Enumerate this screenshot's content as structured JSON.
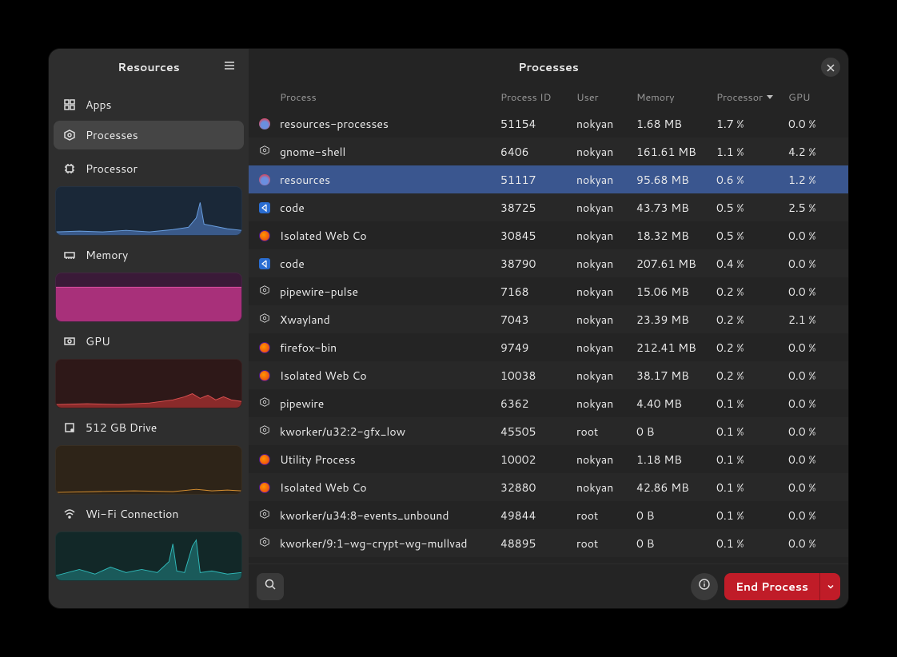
{
  "sidebar": {
    "title": "Resources",
    "apps_label": "Apps",
    "processes_label": "Processes",
    "metrics": {
      "processor": {
        "label": "Processor"
      },
      "memory": {
        "label": "Memory"
      },
      "gpu": {
        "label": "GPU"
      },
      "drive": {
        "label": "512 GB Drive"
      },
      "wifi": {
        "label": "Wi-Fi Connection"
      }
    }
  },
  "main": {
    "title": "Processes",
    "columns": {
      "process": "Process",
      "pid": "Process ID",
      "user": "User",
      "memory": "Memory",
      "cpu": "Processor",
      "gpu": "GPU"
    },
    "sort_column": "cpu",
    "selected_pid": "51117",
    "rows": [
      {
        "icon": "gauge",
        "name": "resources-processes",
        "pid": "51154",
        "user": "nokyan",
        "mem": "1.68 MB",
        "cpu": "1.7 %",
        "gpu": "0.0 %"
      },
      {
        "icon": "gear",
        "name": "gnome-shell",
        "pid": "6406",
        "user": "nokyan",
        "mem": "161.61 MB",
        "cpu": "1.1 %",
        "gpu": "4.2 %"
      },
      {
        "icon": "gauge",
        "name": "resources",
        "pid": "51117",
        "user": "nokyan",
        "mem": "95.68 MB",
        "cpu": "0.6 %",
        "gpu": "1.2 %"
      },
      {
        "icon": "code",
        "name": "code",
        "pid": "38725",
        "user": "nokyan",
        "mem": "43.73 MB",
        "cpu": "0.5 %",
        "gpu": "2.5 %"
      },
      {
        "icon": "firefox",
        "name": "Isolated Web Co",
        "pid": "30845",
        "user": "nokyan",
        "mem": "18.32 MB",
        "cpu": "0.5 %",
        "gpu": "0.0 %"
      },
      {
        "icon": "code",
        "name": "code",
        "pid": "38790",
        "user": "nokyan",
        "mem": "207.61 MB",
        "cpu": "0.4 %",
        "gpu": "0.0 %"
      },
      {
        "icon": "gear",
        "name": "pipewire-pulse",
        "pid": "7168",
        "user": "nokyan",
        "mem": "15.06 MB",
        "cpu": "0.2 %",
        "gpu": "0.0 %"
      },
      {
        "icon": "gear",
        "name": "Xwayland",
        "pid": "7043",
        "user": "nokyan",
        "mem": "23.39 MB",
        "cpu": "0.2 %",
        "gpu": "2.1 %"
      },
      {
        "icon": "firefox",
        "name": "firefox-bin",
        "pid": "9749",
        "user": "nokyan",
        "mem": "212.41 MB",
        "cpu": "0.2 %",
        "gpu": "0.0 %"
      },
      {
        "icon": "firefox",
        "name": "Isolated Web Co",
        "pid": "10038",
        "user": "nokyan",
        "mem": "38.17 MB",
        "cpu": "0.2 %",
        "gpu": "0.0 %"
      },
      {
        "icon": "gear",
        "name": "pipewire",
        "pid": "6362",
        "user": "nokyan",
        "mem": "4.40 MB",
        "cpu": "0.1 %",
        "gpu": "0.0 %"
      },
      {
        "icon": "gear",
        "name": "kworker/u32:2-gfx_low",
        "pid": "45505",
        "user": "root",
        "mem": "0 B",
        "cpu": "0.1 %",
        "gpu": "0.0 %"
      },
      {
        "icon": "firefox",
        "name": "Utility Process",
        "pid": "10002",
        "user": "nokyan",
        "mem": "1.18 MB",
        "cpu": "0.1 %",
        "gpu": "0.0 %"
      },
      {
        "icon": "firefox",
        "name": "Isolated Web Co",
        "pid": "32880",
        "user": "nokyan",
        "mem": "42.86 MB",
        "cpu": "0.1 %",
        "gpu": "0.0 %"
      },
      {
        "icon": "gear",
        "name": "kworker/u34:8-events_unbound",
        "pid": "49844",
        "user": "root",
        "mem": "0 B",
        "cpu": "0.1 %",
        "gpu": "0.0 %"
      },
      {
        "icon": "gear",
        "name": "kworker/9:1-wg-crypt-wg-mullvad",
        "pid": "48895",
        "user": "root",
        "mem": "0 B",
        "cpu": "0.1 %",
        "gpu": "0.0 %"
      }
    ]
  },
  "bottom": {
    "end_process": "End Process"
  }
}
